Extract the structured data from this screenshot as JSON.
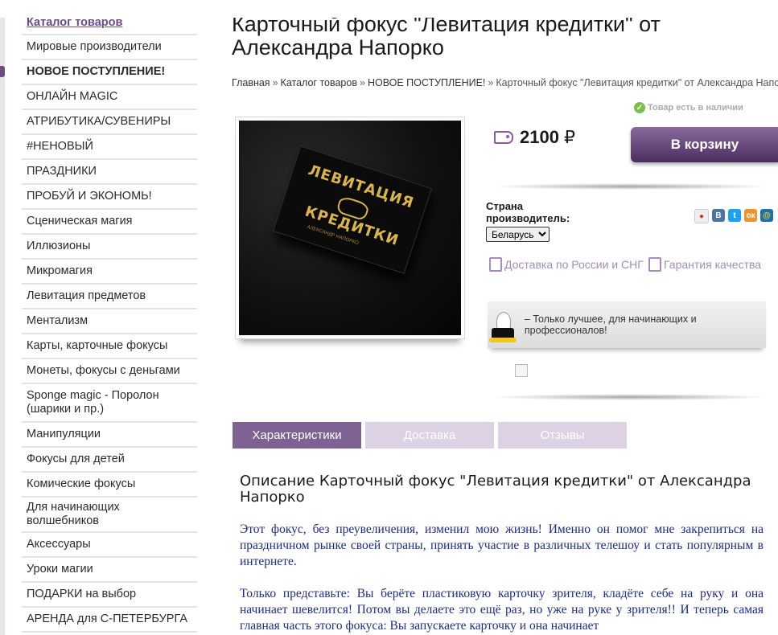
{
  "sidebar": {
    "items": [
      {
        "label": "Каталог товаров"
      },
      {
        "label": "Мировые производители"
      },
      {
        "label": "НОВОЕ ПОСТУПЛЕНИЕ!"
      },
      {
        "label": "ОНЛАЙН MAGIC"
      },
      {
        "label": "АТРИБУТИКА/СУВЕНИРЫ"
      },
      {
        "label": "#НЕНОВЫЙ"
      },
      {
        "label": "ПРАЗДНИКИ"
      },
      {
        "label": "ПРОБУЙ И ЭКОНОМЬ!"
      },
      {
        "label": "Сценическая магия"
      },
      {
        "label": "Иллюзионы"
      },
      {
        "label": "Микромагия"
      },
      {
        "label": "Левитация предметов"
      },
      {
        "label": "Ментализм"
      },
      {
        "label": "Карты, карточные фокусы"
      },
      {
        "label": "Монеты, фокусы с деньгами"
      },
      {
        "label": "Sponge magic - Поролон (шарики и пр.)"
      },
      {
        "label": "Манипуляции"
      },
      {
        "label": "Фокусы для детей"
      },
      {
        "label": "Комические фокусы"
      },
      {
        "label": "Для начинающих волшебников"
      },
      {
        "label": "Аксессуары"
      },
      {
        "label": "Уроки магии"
      },
      {
        "label": "ПОДАРКИ на выбор"
      },
      {
        "label": "АРЕНДА для С-ПЕТЕРБУРГА"
      }
    ]
  },
  "product": {
    "title": "Карточный фокус \"Левитация кредитки\" от Александра Напорко",
    "stock": "Товар есть в наличии",
    "price": "2100",
    "currency": "₽",
    "cart_button": "В корзину",
    "image_text_line1": "ЛЕВИТАЦИЯ",
    "image_text_line2": "КРЕДИТКИ",
    "image_text_sub": "АЛЕКСАНДР НАПОРКО"
  },
  "breadcrumb": {
    "home": "Главная",
    "catalog": "Каталог товаров",
    "section": "НОВОЕ ПОСТУПЛЕНИЕ!",
    "current": "Карточный фокус \"Левитация кредитки\" от Александра Напорко",
    "separator": "»"
  },
  "country": {
    "label": "Страна производитель:",
    "selected": "Беларусь"
  },
  "features": {
    "delivery": "Доставка по России и СНГ",
    "quality": "Гарантия качества"
  },
  "promo": {
    "text": "– Только лучшее, для начинающих и профессионалов!"
  },
  "tabs": [
    {
      "label": "Характеристики",
      "active": true
    },
    {
      "label": "Доставка",
      "active": false
    },
    {
      "label": "Отзывы",
      "active": false
    }
  ],
  "description": {
    "title": "Описание Карточный фокус \"Левитация кредитки\" от Александра Напорко",
    "paragraphs": [
      "Этот фокус, без преувеличения, изменил мою жизнь! Именно он помог мне закрепиться на праздничном рынке своей страны, принять участие в различных телешоу и стать популярным в интернете.",
      "Только представьте: Вы берёте пластиковую карточку зрителя, кладёте себе на руку и она начинает шевелится! Потом вы делаете это ещё раз, но уже на руке у зрителя!! И теперь самая главная часть этого фокуса: Вы запускаете карточку и она начинает"
    ]
  },
  "colors": {
    "accent": "#7d6293",
    "tab_inactive": "#dcd2e3",
    "description_text": "#1f2a8a"
  }
}
